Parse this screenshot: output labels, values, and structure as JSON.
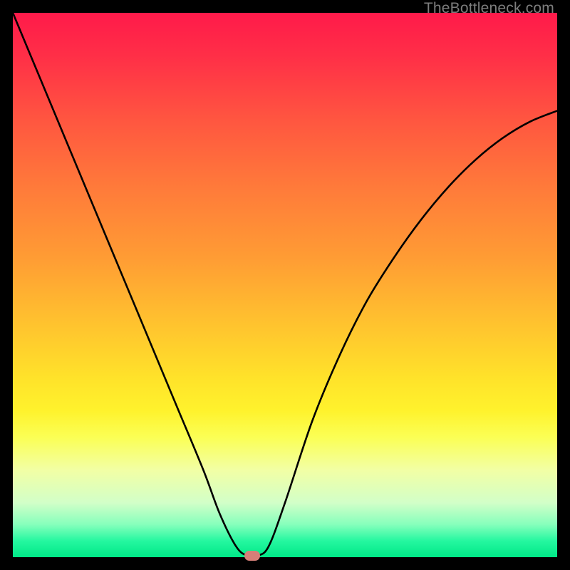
{
  "watermark": "TheBottleneck.com",
  "colors": {
    "curve_stroke": "#000000",
    "marker_fill": "#d67f78",
    "frame_bg": "#000000"
  },
  "chart_data": {
    "type": "line",
    "title": "",
    "xlabel": "",
    "ylabel": "",
    "xlim": [
      0,
      100
    ],
    "ylim": [
      0,
      100
    ],
    "grid": false,
    "legend": false,
    "series": [
      {
        "name": "bottleneck-curve",
        "x": [
          0,
          5,
          10,
          15,
          20,
          25,
          30,
          35,
          38,
          41,
          43,
          45,
          47,
          50,
          55,
          60,
          65,
          70,
          75,
          80,
          85,
          90,
          95,
          100
        ],
        "values": [
          100,
          88,
          76,
          64,
          52,
          40,
          28,
          16,
          8,
          2,
          0.3,
          0.3,
          2,
          10,
          25,
          37,
          47,
          55,
          62,
          68,
          73,
          77,
          80,
          82
        ]
      }
    ],
    "annotations": [
      {
        "name": "min-marker",
        "x": 44,
        "y": 0.3
      }
    ]
  }
}
